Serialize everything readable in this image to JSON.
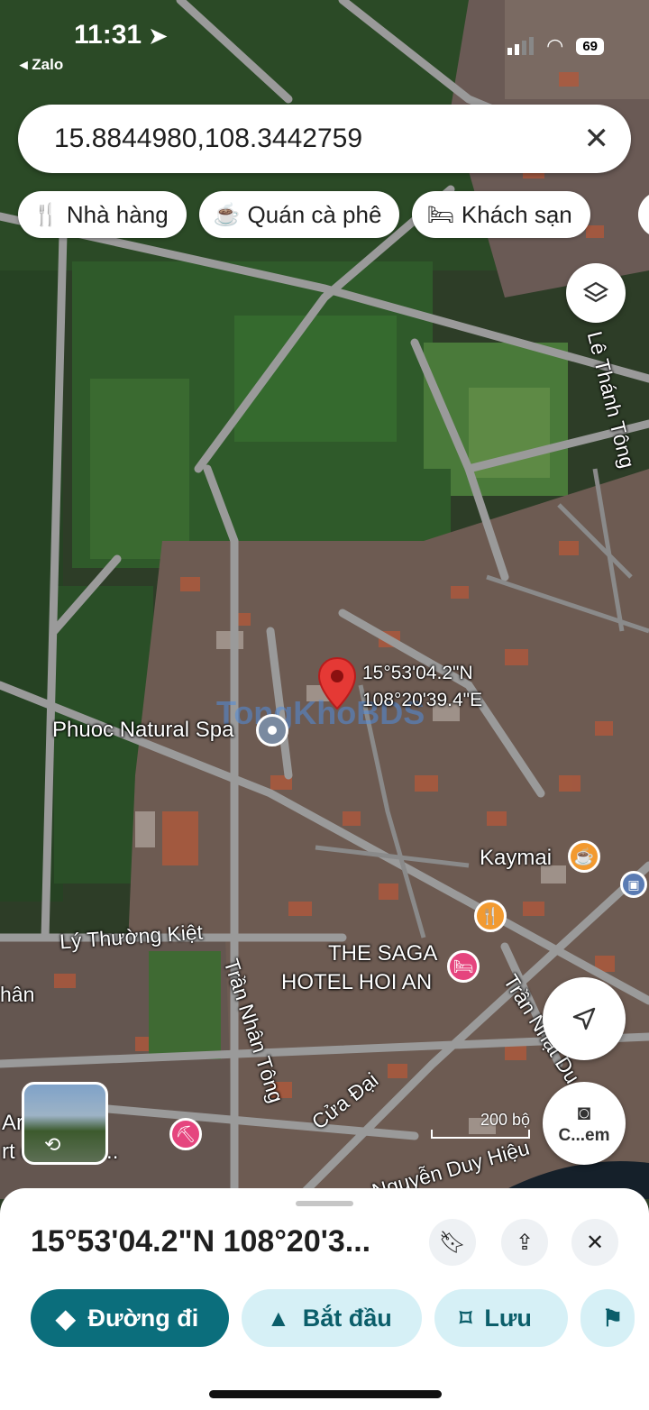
{
  "status_bar": {
    "time": "11:31",
    "back_app": "◂ Zalo",
    "battery": "69"
  },
  "search": {
    "value": "15.8844980,108.3442759",
    "placeholder": ""
  },
  "chips": [
    {
      "icon": "restaurant-icon",
      "label": "Nhà hàng"
    },
    {
      "icon": "coffee-icon",
      "label": "Quán cà phê"
    },
    {
      "icon": "hotel-icon",
      "label": "Khách sạn"
    }
  ],
  "map": {
    "pin_label_lat": "15°53'04.2\"N",
    "pin_label_lon": "108°20'39.4\"E",
    "watermark": "TongKhoBDS",
    "labels": {
      "street_le_thanh_tong": "Lê Thánh Tông",
      "poi_phuoc_spa": "Phuoc Natural Spa",
      "poi_kaymai": "Kaymai",
      "street_ly_thuong_kiet": "Lý Thường Kiệt",
      "street_tran_nhan_tong": "Trần Nhân Tông",
      "poi_saga_line1": "THE SAGA",
      "poi_saga_line2": "HOTEL HOI AN",
      "street_tran_nhat_duat": "Trần Nhật Du",
      "street_cua_dai": "Cửa Đại",
      "street_nguyen_duy_hieu": "Nguyễn Duy Hiệu",
      "edge_nhan": "hân",
      "poi_left_line1": "Ar      ouse",
      "poi_left_line2": "rt c     Khu...",
      "camera_label": "C...em"
    },
    "scale": "200 bộ"
  },
  "sheet": {
    "title": "15°53'04.2\"N 108°20'3...",
    "actions": [
      {
        "label": "Đường đi",
        "icon": "directions-icon"
      },
      {
        "label": "Bắt đầu",
        "icon": "navigate-icon"
      },
      {
        "label": "Lưu",
        "icon": "bookmark-icon"
      }
    ]
  },
  "colors": {
    "pin": "#e53935",
    "primary": "#0b6e7c",
    "poi_orange": "#f29a30",
    "poi_pink": "#e5457e"
  }
}
